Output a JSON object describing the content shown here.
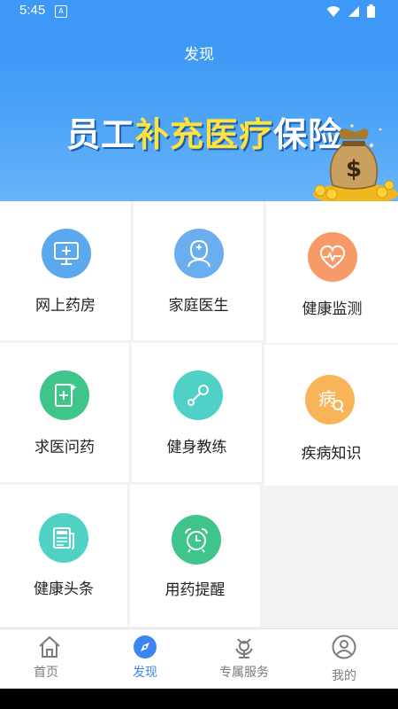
{
  "status_bar": {
    "time": "5:45",
    "app_badge": "A"
  },
  "header": {
    "title": "发现"
  },
  "banner": {
    "text_white_1": "员工",
    "text_yellow": "补充医疗",
    "text_white_2": "保险",
    "bag_symbol": "$"
  },
  "features": [
    {
      "label": "网上药房",
      "icon": "monitor-plus-icon",
      "color": "#5ba8ec"
    },
    {
      "label": "家庭医生",
      "icon": "doctor-icon",
      "color": "#6aaef0"
    },
    {
      "label": "健康监测",
      "icon": "heart-pulse-icon",
      "color": "#f59a68"
    },
    {
      "label": "求医问药",
      "icon": "medical-book-icon",
      "color": "#3fc48a"
    },
    {
      "label": "健身教练",
      "icon": "dumbbell-icon",
      "color": "#4fd1c5"
    },
    {
      "label": "疾病知识",
      "icon": "disease-search-icon",
      "color": "#f9b45a",
      "icon_char": "病"
    },
    {
      "label": "健康头条",
      "icon": "newspaper-icon",
      "color": "#4fd1c5"
    },
    {
      "label": "用药提醒",
      "icon": "alarm-clock-icon",
      "color": "#3fc48a"
    }
  ],
  "tabs": [
    {
      "label": "首页",
      "icon": "home-icon",
      "active": false
    },
    {
      "label": "发现",
      "icon": "compass-icon",
      "active": true
    },
    {
      "label": "专属服务",
      "icon": "service-icon",
      "active": false
    },
    {
      "label": "我的",
      "icon": "user-icon",
      "active": false
    }
  ],
  "colors": {
    "header_blue": "#3d98f6",
    "active_tab": "#3b86f0",
    "banner_yellow": "#ffe23a"
  }
}
